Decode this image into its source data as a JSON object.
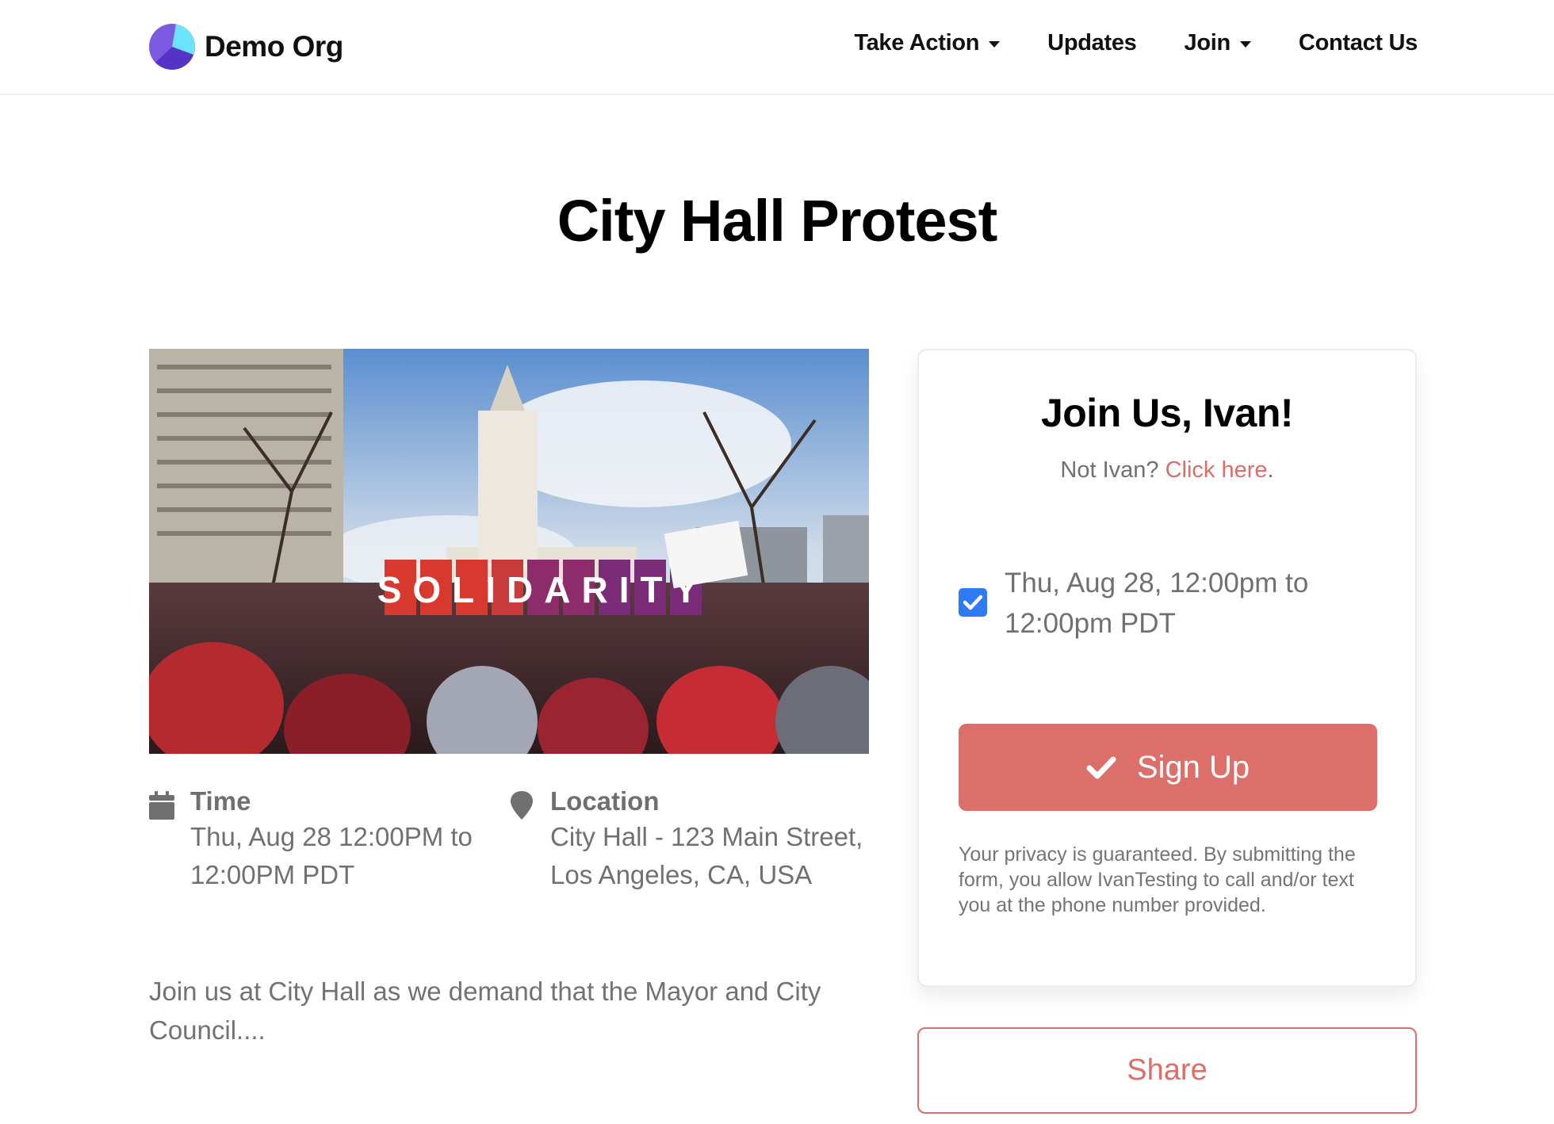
{
  "header": {
    "org_name": "Demo Org",
    "nav": [
      {
        "label": "Take Action",
        "has_dropdown": true
      },
      {
        "label": "Updates",
        "has_dropdown": false
      },
      {
        "label": "Join",
        "has_dropdown": true
      },
      {
        "label": "Contact Us",
        "has_dropdown": false
      }
    ]
  },
  "event": {
    "title": "City Hall Protest",
    "image_alt": "Crowd rally in front of City Hall holding SOLIDARITY letter signs",
    "image_sign_text": "SOLIDARITY",
    "time_label": "Time",
    "time_value": "Thu, Aug 28 12:00PM to 12:00PM PDT",
    "location_label": "Location",
    "location_value": "City Hall - 123 Main Street, Los Angeles, CA, USA",
    "description": "Join us at City Hall as we demand that the Mayor and City Council...."
  },
  "signup_card": {
    "title": "Join Us, Ivan!",
    "not_user_prefix": "Not Ivan? ",
    "not_user_link": "Click here",
    "not_user_suffix": ".",
    "shift_checked": true,
    "shift_label": "Thu, Aug 28, 12:00pm to 12:00pm PDT",
    "signup_button": "Sign Up",
    "privacy_text": "Your privacy is guaranteed. By submitting the form, you allow IvanTesting to call and/or text you at the phone number provided."
  },
  "share_button": "Share",
  "colors": {
    "accent": "#dc6f69",
    "checkbox": "#2f7bf5",
    "muted_text": "#707070"
  }
}
